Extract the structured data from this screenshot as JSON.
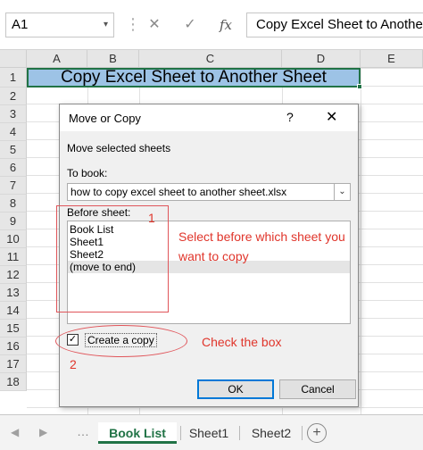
{
  "formula_bar": {
    "name_box": "A1",
    "name_box_arrow": "▾",
    "separator": "⋮",
    "cancel_icon": "✕",
    "enter_icon": "✓",
    "fx_label": "fx",
    "content": "Copy Excel Sheet to Another Sheet"
  },
  "grid": {
    "columns": [
      "A",
      "B",
      "C",
      "D",
      "E"
    ],
    "rows": [
      "1",
      "2",
      "3",
      "4",
      "5",
      "6",
      "7",
      "8",
      "9",
      "10",
      "11",
      "12",
      "13",
      "14",
      "15",
      "16",
      "17",
      "18"
    ],
    "cell_a1": "Copy Excel Sheet to Another Sheet",
    "selection_color": "#217346",
    "title_fill": "#9dc3e6"
  },
  "dialog": {
    "title": "Move or Copy",
    "help": "?",
    "close": "✕",
    "heading": "Move selected sheets",
    "to_book_label": "To book:",
    "to_book_value": "how to copy excel sheet to another sheet.xlsx",
    "combo_arrow": "⌄",
    "before_sheet_label": "Before sheet:",
    "sheets": [
      "Book List",
      "Sheet1",
      "Sheet2",
      "(move to end)"
    ],
    "selected_index": 3,
    "create_copy_label": "Create a copy",
    "create_copy_checked": "✓",
    "ok_label": "OK",
    "cancel_label": "Cancel"
  },
  "annotations": {
    "marker1": "1",
    "text1": "Select before which sheet you want to copy",
    "marker2": "2",
    "text2": "Check the box",
    "color": "#e0352b"
  },
  "tabs": {
    "nav_left": "◀",
    "nav_right": "▶",
    "dots": "…",
    "sheets": [
      "Book List",
      "Sheet1",
      "Sheet2"
    ],
    "active": "Book List",
    "add": "+"
  }
}
